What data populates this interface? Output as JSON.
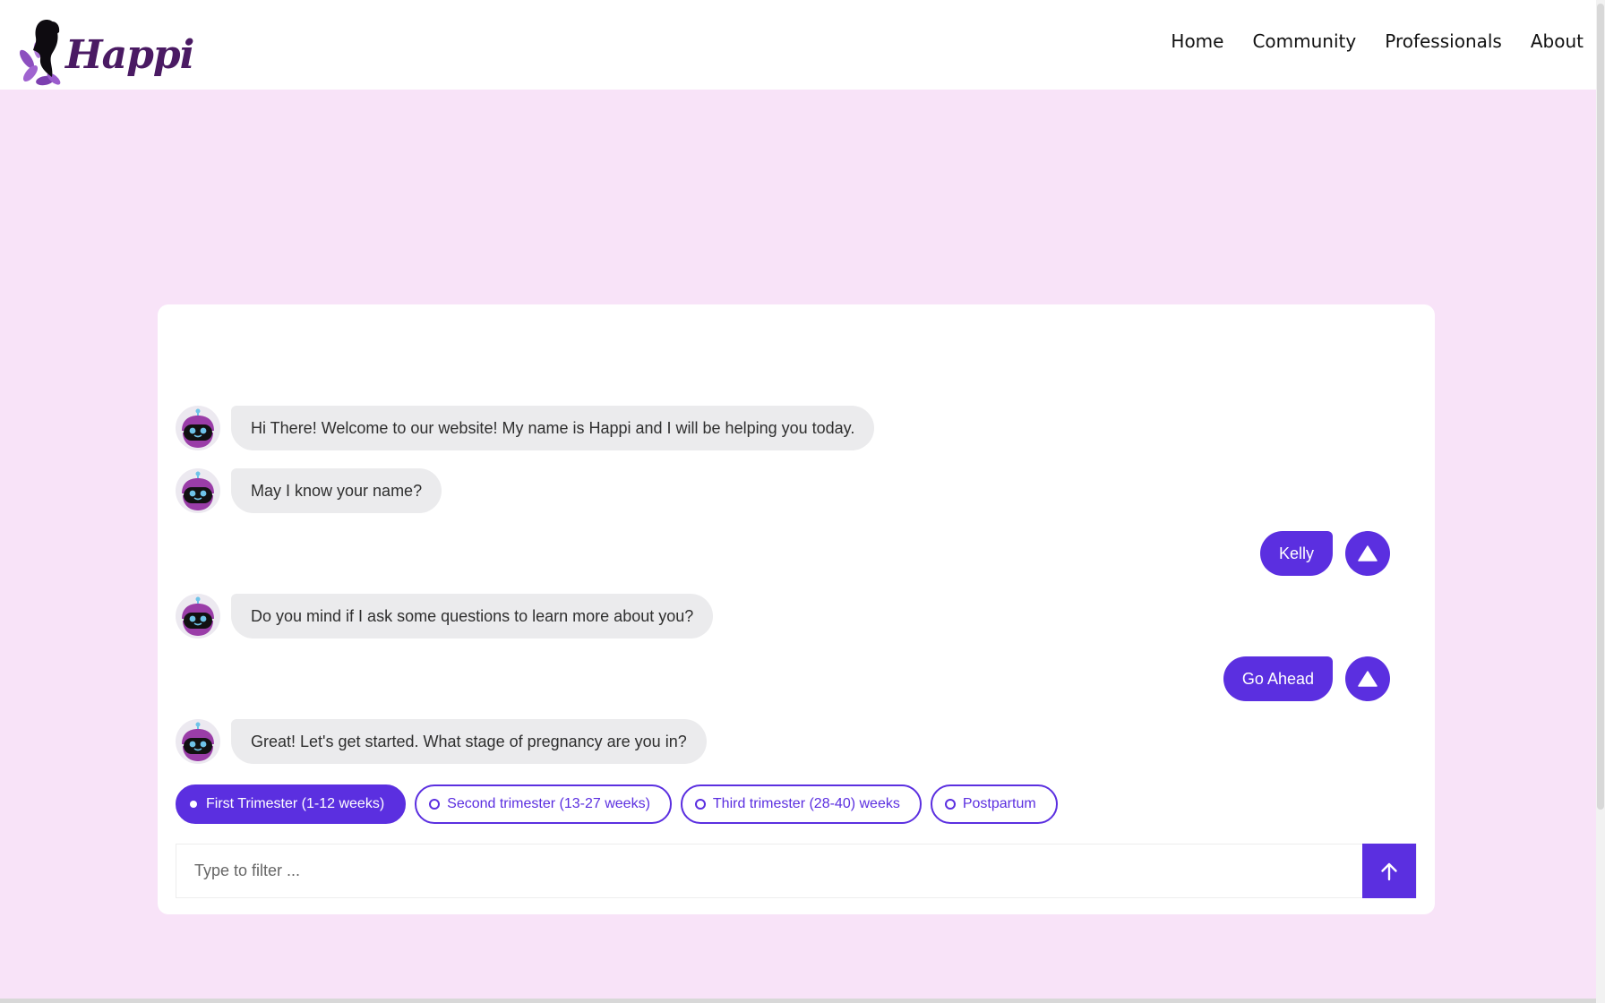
{
  "brand": {
    "name": "Happi"
  },
  "nav": {
    "items": [
      "Home",
      "Community",
      "Professionals",
      "About"
    ]
  },
  "chat": {
    "messages": [
      {
        "from": "bot",
        "text": "Hi There! Welcome to our website! My name is Happi and I will be helping you today."
      },
      {
        "from": "bot",
        "text": "May I know your name?"
      },
      {
        "from": "user",
        "text": "Kelly"
      },
      {
        "from": "bot",
        "text": "Do you mind if I ask some questions to learn more about you?"
      },
      {
        "from": "user",
        "text": "Go Ahead"
      },
      {
        "from": "bot",
        "text": "Great! Let's get started. What stage of pregnancy are you in?"
      }
    ],
    "options": [
      {
        "label": "First Trimester (1-12 weeks)",
        "selected": true
      },
      {
        "label": "Second trimester (13-27 weeks)",
        "selected": false
      },
      {
        "label": "Third trimester (28-40) weeks",
        "selected": false
      },
      {
        "label": "Postpartum",
        "selected": false
      }
    ],
    "input": {
      "placeholder": "Type to filter ...",
      "value": ""
    },
    "send_icon": "arrow-up-icon"
  },
  "colors": {
    "accent": "#5b2fe0",
    "page_background": "#f8e3f8",
    "bot_bubble": "#ebebed",
    "brand_text": "#4a1a63"
  }
}
